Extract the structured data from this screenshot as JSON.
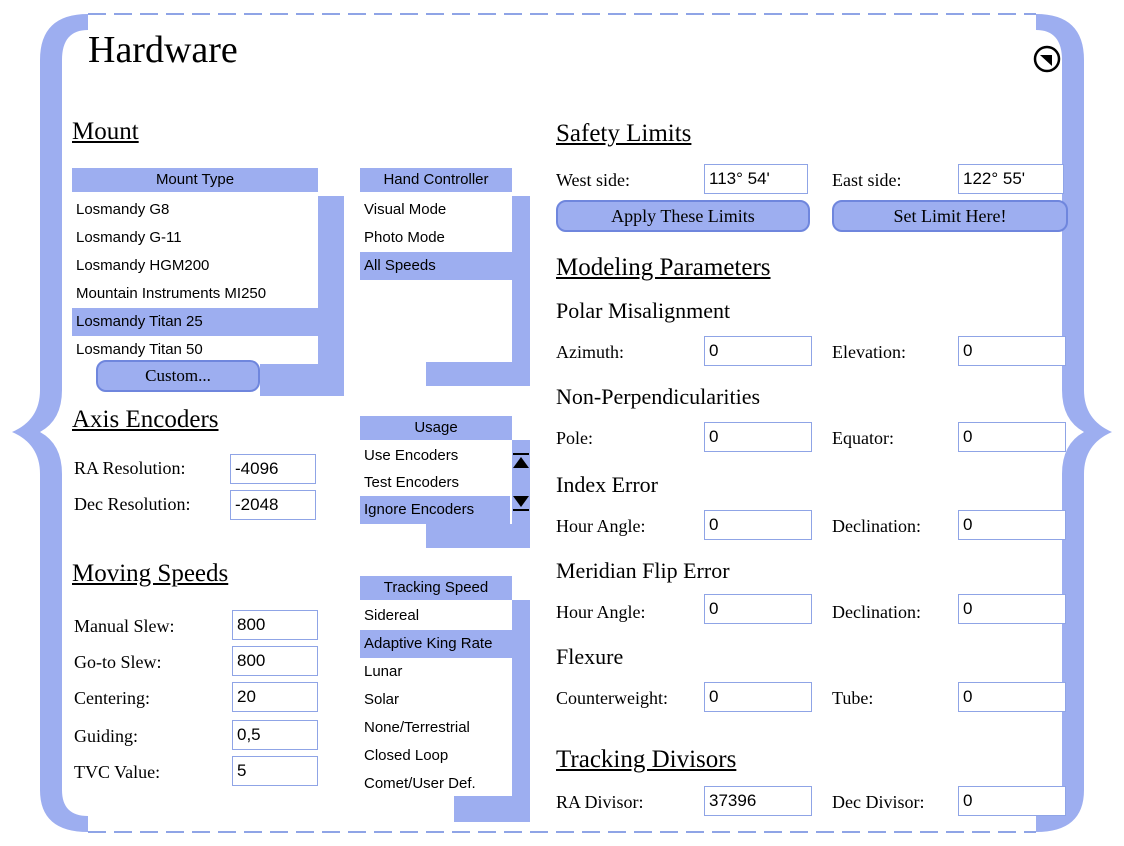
{
  "title": "Hardware",
  "colors": {
    "accent": "#9daef0",
    "border": "#8fa4e6"
  },
  "mount": {
    "heading": "Mount",
    "list_header": "Mount Type",
    "items": [
      "Losmandy G8",
      "Losmandy G-11",
      "Losmandy HGM200",
      "Mountain Instruments MI250",
      "Losmandy Titan 25",
      "Losmandy Titan 50"
    ],
    "selected": "Losmandy Titan 25",
    "custom_button": "Custom..."
  },
  "hand_controller": {
    "header": "Hand Controller",
    "items": [
      "Visual Mode",
      "Photo Mode",
      "All Speeds"
    ],
    "selected": "All Speeds"
  },
  "axis_encoders": {
    "heading": "Axis Encoders",
    "ra_label": "RA Resolution:",
    "ra_value": "-4096",
    "dec_label": "Dec Resolution:",
    "dec_value": "-2048"
  },
  "usage": {
    "header": "Usage",
    "items": [
      "Use Encoders",
      "Test Encoders",
      "Ignore Encoders"
    ],
    "selected": "Ignore Encoders"
  },
  "moving_speeds": {
    "heading": "Moving Speeds",
    "fields": [
      {
        "label": "Manual Slew:",
        "value": "800"
      },
      {
        "label": "Go-to Slew:",
        "value": "800"
      },
      {
        "label": "Centering:",
        "value": "20"
      },
      {
        "label": "Guiding:",
        "value": "0,5"
      },
      {
        "label": "TVC Value:",
        "value": "5"
      }
    ]
  },
  "tracking_speed": {
    "header": "Tracking Speed",
    "items": [
      "Sidereal",
      "Adaptive King Rate",
      "Lunar",
      "Solar",
      "None/Terrestrial",
      "Closed Loop",
      "Comet/User Def."
    ],
    "selected": "Adaptive King Rate"
  },
  "safety_limits": {
    "heading": "Safety Limits",
    "west_label": "West side:",
    "west_value": "113° 54'",
    "east_label": "East side:",
    "east_value": "122° 55'",
    "apply_button": "Apply These Limits",
    "set_button": "Set Limit Here!"
  },
  "modeling": {
    "heading": "Modeling Parameters",
    "polar": {
      "title": "Polar Misalignment",
      "l1": "Azimuth:",
      "v1": "0",
      "l2": "Elevation:",
      "v2": "0"
    },
    "nonperp": {
      "title": "Non-Perpendicularities",
      "l1": "Pole:",
      "v1": "0",
      "l2": "Equator:",
      "v2": "0"
    },
    "index": {
      "title": "Index Error",
      "l1": "Hour Angle:",
      "v1": "0",
      "l2": "Declination:",
      "v2": "0"
    },
    "flip": {
      "title": "Meridian Flip Error",
      "l1": "Hour Angle:",
      "v1": "0",
      "l2": "Declination:",
      "v2": "0"
    },
    "flexure": {
      "title": "Flexure",
      "l1": "Counterweight:",
      "v1": "0",
      "l2": "Tube:",
      "v2": "0"
    }
  },
  "tracking_divisors": {
    "heading": "Tracking Divisors",
    "ra_label": "RA Divisor:",
    "ra_value": "37396",
    "dec_label": "Dec Divisor:",
    "dec_value": "0"
  },
  "icons": {
    "close": "close-icon",
    "scroll_up": "scroll-up-icon",
    "scroll_down": "scroll-down-icon"
  }
}
